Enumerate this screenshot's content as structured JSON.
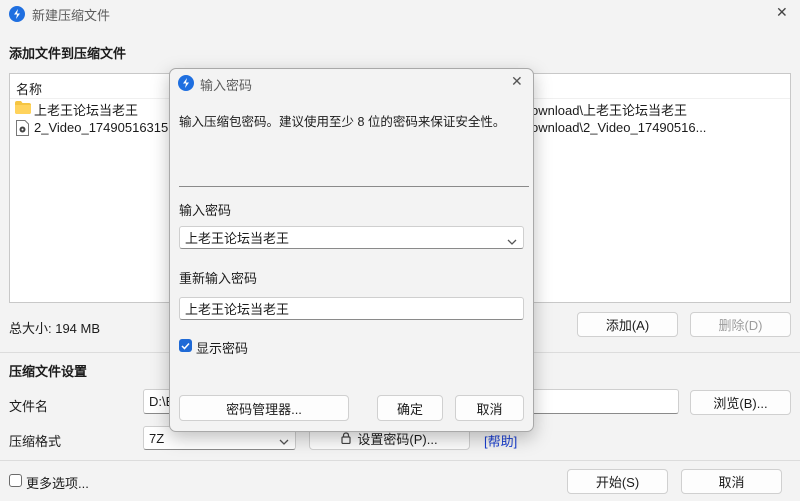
{
  "window": {
    "title": "新建压缩文件",
    "close": "✕"
  },
  "add_section": {
    "title": "添加文件到压缩文件"
  },
  "file_list": {
    "header": "名称",
    "rows": [
      {
        "name": "上老王论坛当老王",
        "path": "ownload\\上老王论坛当老王"
      },
      {
        "name": "2_Video_17490516315",
        "path": "ownload\\2_Video_17490516..."
      }
    ]
  },
  "total_size": "总大小: 194 MB",
  "buttons": {
    "add": "添加(A)",
    "delete": "删除(D)",
    "browse": "浏览(B)...",
    "start": "开始(S)",
    "cancel": "取消"
  },
  "settings": {
    "title": "压缩文件设置",
    "filename_label": "文件名",
    "filename_value": "D:\\E",
    "format_label": "压缩格式",
    "format_value": "7Z",
    "set_password": "设置密码(P)...",
    "help": "[帮助]"
  },
  "more_options": "更多选项...",
  "dialog": {
    "title": "输入密码",
    "close": "✕",
    "description": "输入压缩包密码。建议使用至少 8 位的密码来保证安全性。",
    "password_label": "输入密码",
    "password_value": "上老王论坛当老王",
    "repeat_label": "重新输入密码",
    "repeat_value": "上老王论坛当老王",
    "show_password": "显示密码",
    "manager": "密码管理器...",
    "ok": "确定",
    "cancel": "取消"
  },
  "colors": {
    "accent": "#1f6ad6",
    "link": "#1a3fd1"
  }
}
